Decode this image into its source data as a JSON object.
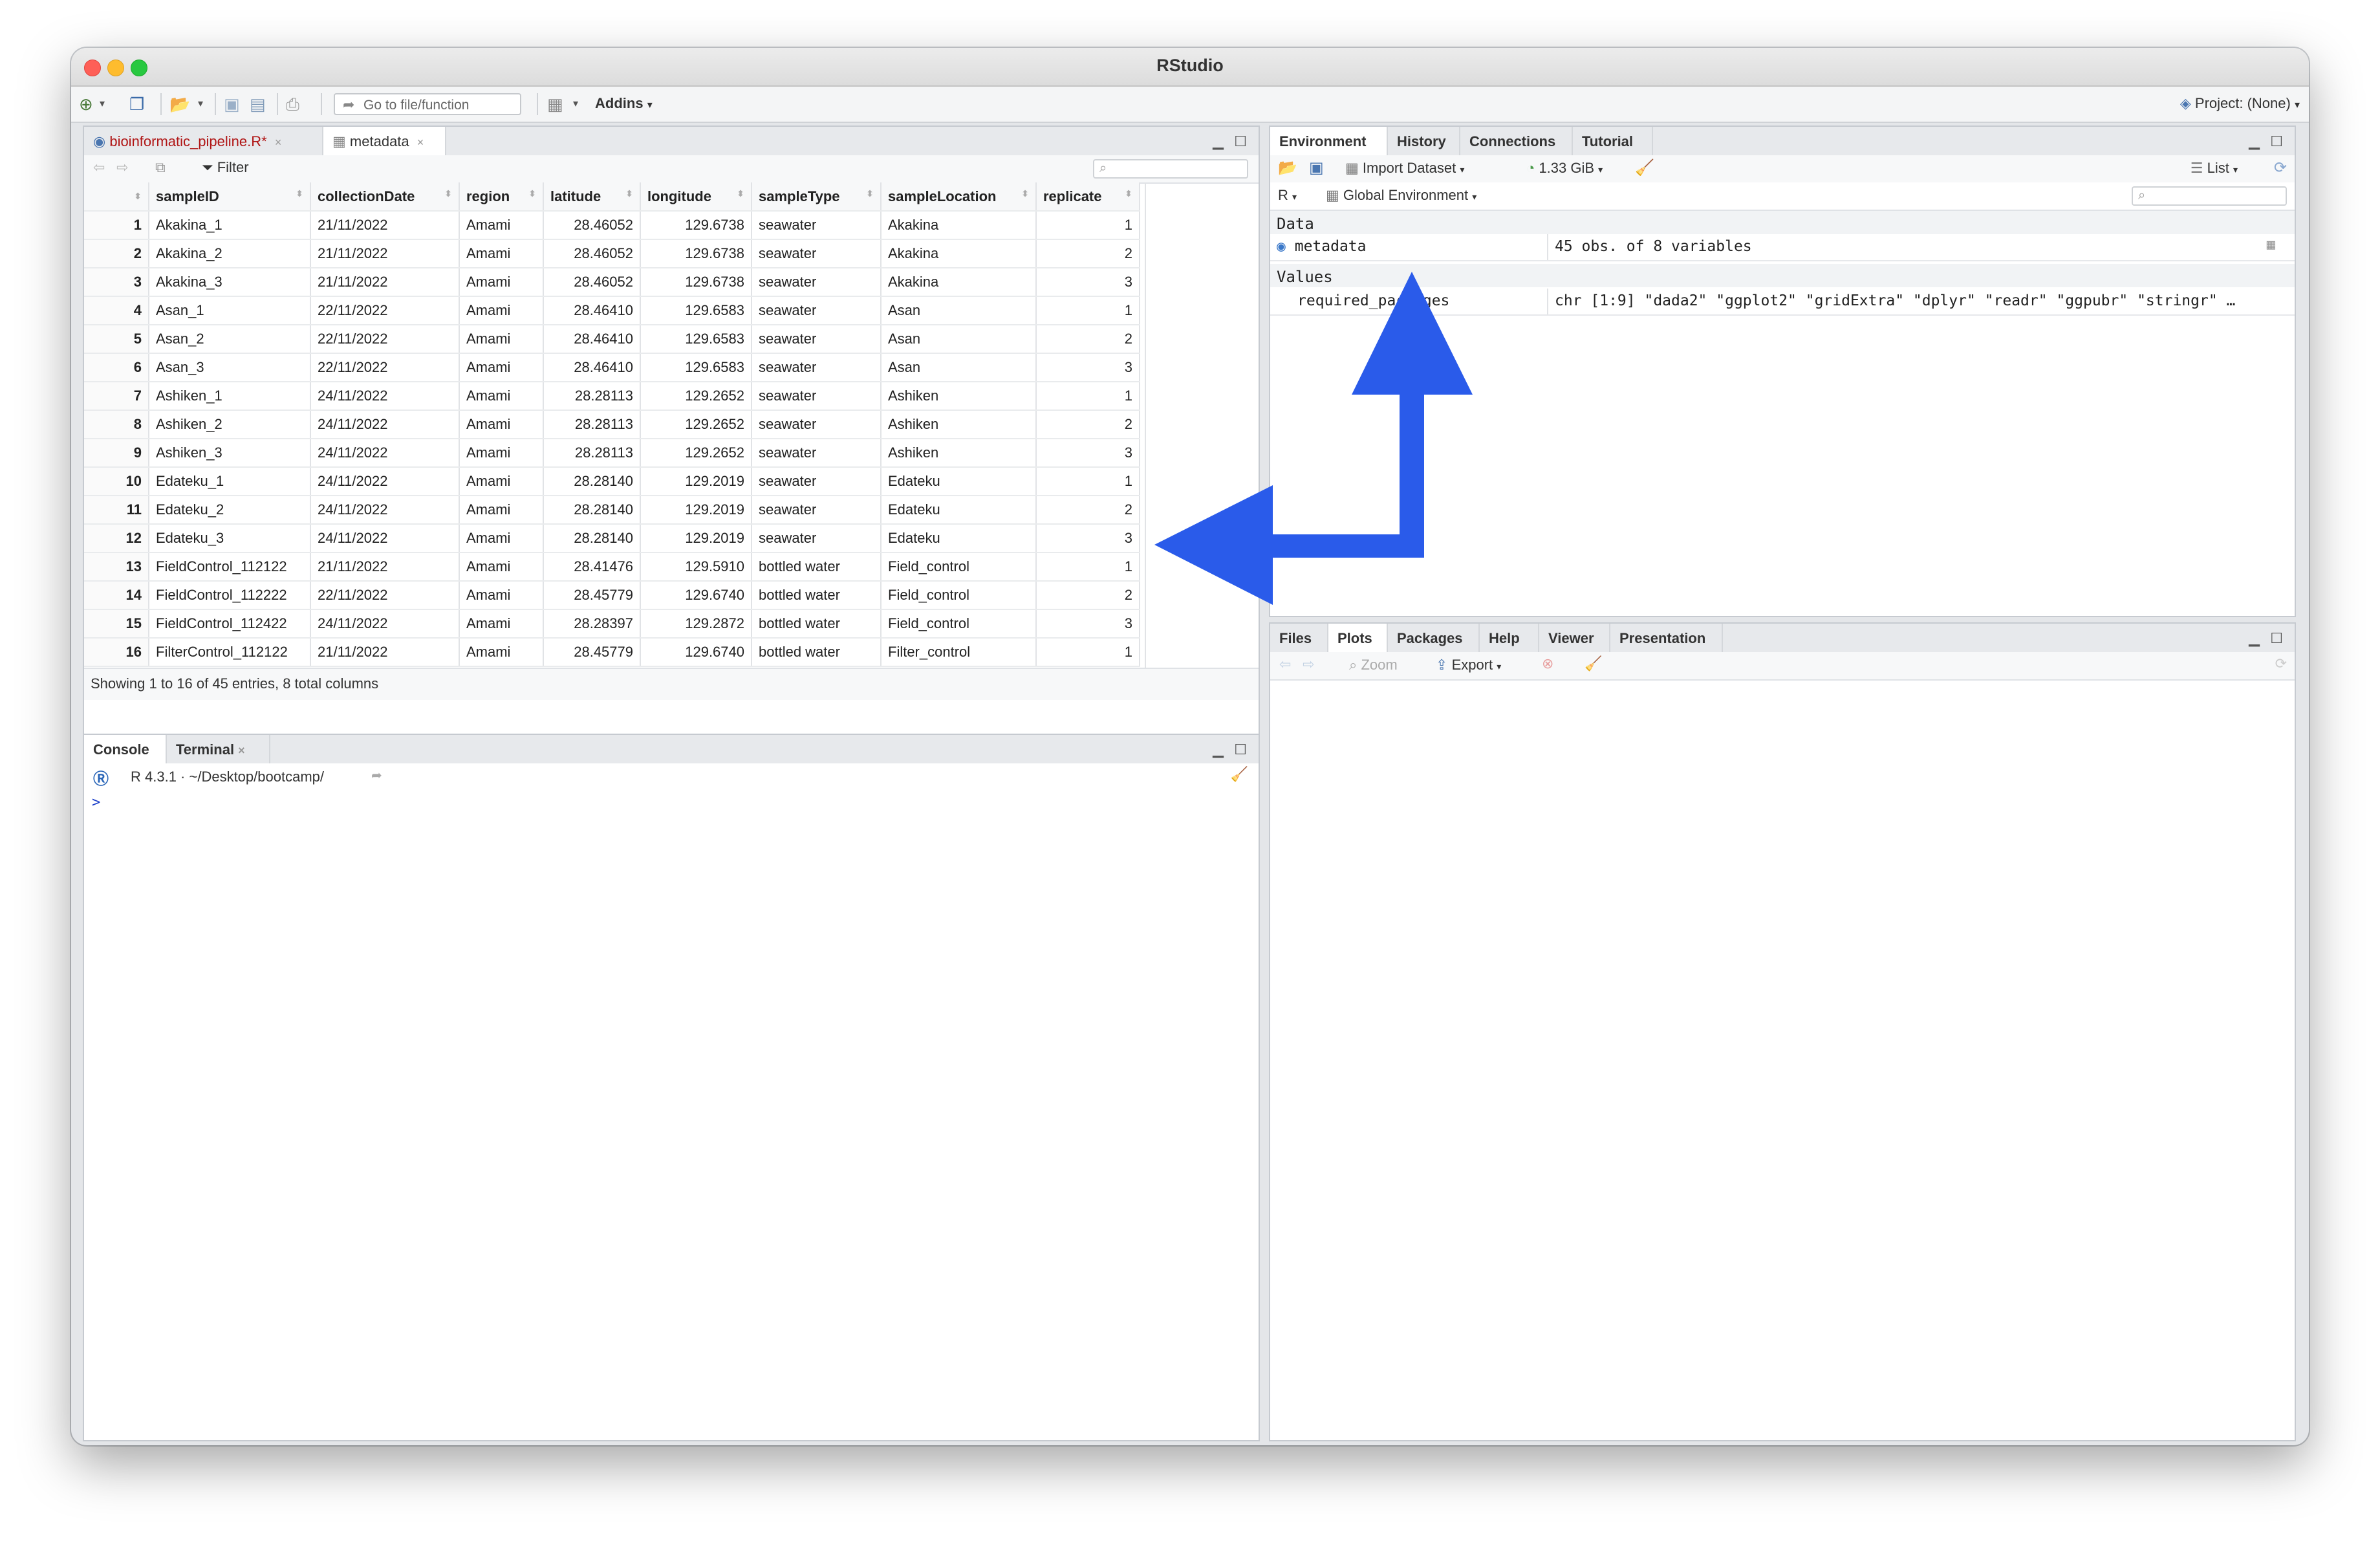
{
  "window": {
    "title": "RStudio"
  },
  "toolbar": {
    "goto_placeholder": "Go to file/function",
    "addins_label": "Addins",
    "project_label": "Project: (None)"
  },
  "source_pane": {
    "tabs": [
      {
        "label": "bioinformatic_pipeline.R*",
        "color": "#b01515"
      },
      {
        "label": "metadata"
      }
    ],
    "filter_label": "Filter",
    "columns": [
      "",
      "sampleID",
      "collectionDate",
      "region",
      "latitude",
      "longitude",
      "sampleType",
      "sampleLocation",
      "replicate"
    ],
    "rows": [
      [
        "1",
        "Akakina_1",
        "21/11/2022",
        "Amami",
        "28.46052",
        "129.6738",
        "seawater",
        "Akakina",
        "1"
      ],
      [
        "2",
        "Akakina_2",
        "21/11/2022",
        "Amami",
        "28.46052",
        "129.6738",
        "seawater",
        "Akakina",
        "2"
      ],
      [
        "3",
        "Akakina_3",
        "21/11/2022",
        "Amami",
        "28.46052",
        "129.6738",
        "seawater",
        "Akakina",
        "3"
      ],
      [
        "4",
        "Asan_1",
        "22/11/2022",
        "Amami",
        "28.46410",
        "129.6583",
        "seawater",
        "Asan",
        "1"
      ],
      [
        "5",
        "Asan_2",
        "22/11/2022",
        "Amami",
        "28.46410",
        "129.6583",
        "seawater",
        "Asan",
        "2"
      ],
      [
        "6",
        "Asan_3",
        "22/11/2022",
        "Amami",
        "28.46410",
        "129.6583",
        "seawater",
        "Asan",
        "3"
      ],
      [
        "7",
        "Ashiken_1",
        "24/11/2022",
        "Amami",
        "28.28113",
        "129.2652",
        "seawater",
        "Ashiken",
        "1"
      ],
      [
        "8",
        "Ashiken_2",
        "24/11/2022",
        "Amami",
        "28.28113",
        "129.2652",
        "seawater",
        "Ashiken",
        "2"
      ],
      [
        "9",
        "Ashiken_3",
        "24/11/2022",
        "Amami",
        "28.28113",
        "129.2652",
        "seawater",
        "Ashiken",
        "3"
      ],
      [
        "10",
        "Edateku_1",
        "24/11/2022",
        "Amami",
        "28.28140",
        "129.2019",
        "seawater",
        "Edateku",
        "1"
      ],
      [
        "11",
        "Edateku_2",
        "24/11/2022",
        "Amami",
        "28.28140",
        "129.2019",
        "seawater",
        "Edateku",
        "2"
      ],
      [
        "12",
        "Edateku_3",
        "24/11/2022",
        "Amami",
        "28.28140",
        "129.2019",
        "seawater",
        "Edateku",
        "3"
      ],
      [
        "13",
        "FieldControl_112122",
        "21/11/2022",
        "Amami",
        "28.41476",
        "129.5910",
        "bottled water",
        "Field_control",
        "1"
      ],
      [
        "14",
        "FieldControl_112222",
        "22/11/2022",
        "Amami",
        "28.45779",
        "129.6740",
        "bottled water",
        "Field_control",
        "2"
      ],
      [
        "15",
        "FieldControl_112422",
        "24/11/2022",
        "Amami",
        "28.28397",
        "129.2872",
        "bottled water",
        "Field_control",
        "3"
      ],
      [
        "16",
        "FilterControl_112122",
        "21/11/2022",
        "Amami",
        "28.45779",
        "129.6740",
        "bottled water",
        "Filter_control",
        "1"
      ]
    ],
    "footer": "Showing 1 to 16 of 45 entries, 8 total columns"
  },
  "console_pane": {
    "tabs": [
      {
        "label": "Console"
      },
      {
        "label": "Terminal"
      }
    ],
    "path": "R 4.3.1 · ~/Desktop/bootcamp/",
    "prompt": ">"
  },
  "env_pane": {
    "tabs": [
      {
        "label": "Environment"
      },
      {
        "label": "History"
      },
      {
        "label": "Connections"
      },
      {
        "label": "Tutorial"
      }
    ],
    "import_label": "Import Dataset",
    "memory_label": "1.33 GiB",
    "list_label": "List",
    "r_label": "R",
    "scope_label": "Global Environment",
    "data_header": "Data",
    "data_rows": [
      {
        "name": "metadata",
        "value": "45 obs. of 8 variables"
      }
    ],
    "values_header": "Values",
    "value_rows": [
      {
        "name": "required_packages",
        "value": "chr [1:9] \"dada2\" \"ggplot2\" \"gridExtra\" \"dplyr\" \"readr\" \"ggpubr\" \"stringr\" …"
      }
    ]
  },
  "files_pane": {
    "tabs": [
      {
        "label": "Files"
      },
      {
        "label": "Plots"
      },
      {
        "label": "Packages"
      },
      {
        "label": "Help"
      },
      {
        "label": "Viewer"
      },
      {
        "label": "Presentation"
      }
    ],
    "zoom_label": "Zoom",
    "export_label": "Export"
  },
  "annotation": {
    "arrow_color": "#2a5bea"
  }
}
